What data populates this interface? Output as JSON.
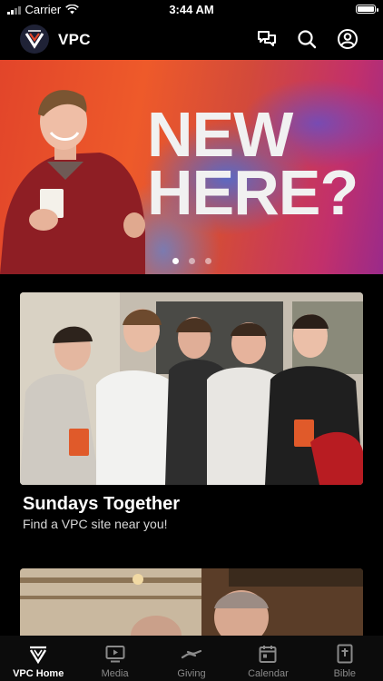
{
  "status_bar": {
    "carrier": "Carrier",
    "time": "3:44 AM"
  },
  "nav": {
    "brand": "VPC",
    "icons": [
      "chat-icon",
      "search-icon",
      "profile-icon"
    ]
  },
  "hero": {
    "headline_line1": "NEW",
    "headline_line2": "HERE?",
    "slide_count": 3,
    "active_slide": 1
  },
  "featured_card": {
    "title": "Sundays Together",
    "subtitle": "Find a VPC site near you!"
  },
  "tabs": [
    {
      "label": "VPC Home",
      "icon": "vpc-logo-icon",
      "active": true
    },
    {
      "label": "Media",
      "icon": "media-icon",
      "active": false
    },
    {
      "label": "Giving",
      "icon": "giving-icon",
      "active": false
    },
    {
      "label": "Calendar",
      "icon": "calendar-icon",
      "active": false
    },
    {
      "label": "Bible",
      "icon": "bible-icon",
      "active": false
    }
  ],
  "colors": {
    "background": "#000000",
    "tab_bar": "#0c0c0c",
    "inactive_tab": "#8a8a8a",
    "hero_accent": "#ee5a2a"
  }
}
